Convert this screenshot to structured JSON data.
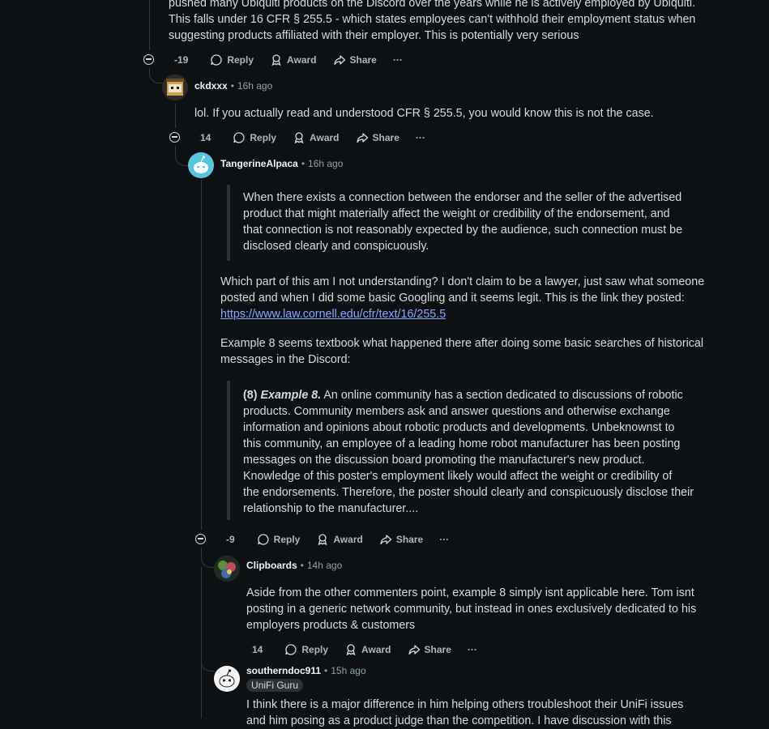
{
  "top_comment": {
    "text_lines": [
      "pushed many Ubiquiti products on the Discord over the years while he is actively employed by Ubiquiti.",
      "This falls under 16 CFR § 255.5 - which states employees can't withhold their employment status when",
      "suggesting products affiliated with their employer. This is potentially very serious"
    ],
    "score": "-19"
  },
  "actions": {
    "reply": "Reply",
    "award": "Award",
    "share": "Share",
    "more": "···"
  },
  "comment_ckd": {
    "user": "ckdxxx",
    "dot": "•",
    "time": "16h ago",
    "text": "lol. If you actually read and understood CFR § 255.5, you would know this is not the case.",
    "score": "14"
  },
  "comment_tangerine": {
    "user": "TangerineAlpaca",
    "dot": "•",
    "time": "16h ago",
    "quote1_lines": [
      "When there exists a connection between the endorser and the seller of the advertised",
      "product that might materially affect the weight or credibility of the endorsement, and",
      "that connection is not reasonably expected by the audience, such connection must be",
      "disclosed clearly and conspicuously."
    ],
    "para1_lines": [
      "Which part of this am I not understanding? I don't claim to be a lawyer, just saw what someone",
      "posted and when I did some basic Googling and it seems legit. This is the link they posted:"
    ],
    "link": "https://www.law.cornell.edu/cfr/text/16/255.5",
    "para2_lines": [
      "Example 8 seems textbook what happened there after doing some basic searches of historical",
      "messages in the Discord:"
    ],
    "quote2_num": "(8)",
    "quote2_title": "Example 8.",
    "quote2_first": " An online community has a section dedicated to discussions of robotic",
    "quote2_lines": [
      "products. Community members ask and answer questions and otherwise exchange",
      "information and opinions about robotic products and developments. Unbeknownst to",
      "this community, an employee of a leading home robot manufacturer has been posting",
      "messages on the discussion board promoting the manufacturer's new product.",
      "Knowledge of this poster's employment likely would affect the weight or credibility of",
      "the endorsements. Therefore, the poster should clearly and conspicuously disclose their",
      "relationship to the manufacturer...."
    ],
    "score": "-9"
  },
  "comment_clip": {
    "user": "Clipboards",
    "dot": "•",
    "time": "14h ago",
    "text_lines": [
      "Aside from the other commenters point, example 8 simply isnt applicable here. Tom isnt",
      "posting in a generic network community, but instead in ones exclusively dedicated to his",
      "employers products & customers"
    ],
    "score": "14"
  },
  "comment_south": {
    "user": "southerndoc911",
    "dot": "•",
    "time": "15h ago",
    "flair": "UniFi Guru",
    "text_lines": [
      "I think there is a major difference in him helping others troubleshoot their UniFi issues",
      "and him posing as a product judge than the competition. I have discussion with this"
    ]
  },
  "colors": {
    "background": "#0e1113",
    "text": "#d7dadc",
    "link": "#87a8ff",
    "thread": "#33393d"
  }
}
